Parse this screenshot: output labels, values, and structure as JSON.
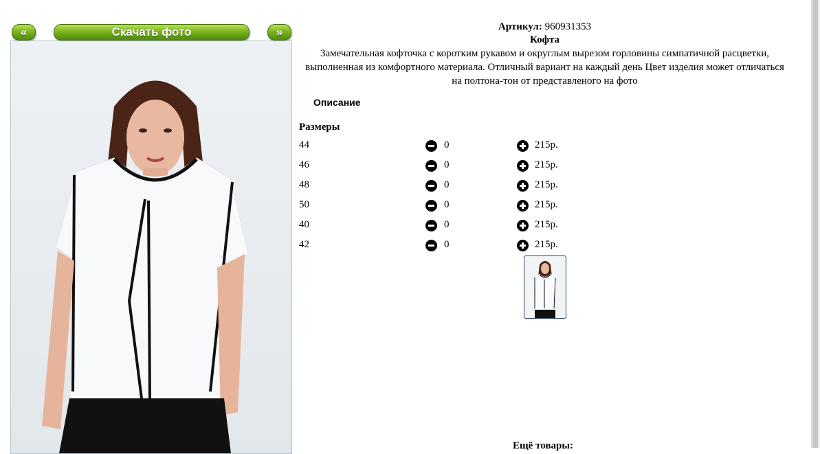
{
  "nav": {
    "prev_label": "«",
    "download_label": "Скачать фото",
    "next_label": "»"
  },
  "product": {
    "article_label": "Артикул:",
    "article_value": "960931353",
    "title": "Кофта",
    "description": "Замечательная кофточка с коротким рукавом и округлым вырезом горловины симпатичной расцветки, выполненная из комфортного материала. Отличный вариант на каждый день Цвет изделия может отличаться на полтона-тон от представленого на фото",
    "description_link": "Описание"
  },
  "sizes": {
    "title": "Размеры",
    "rows": [
      {
        "size": "44",
        "qty": "0",
        "price": "215р."
      },
      {
        "size": "46",
        "qty": "0",
        "price": "215р."
      },
      {
        "size": "48",
        "qty": "0",
        "price": "215р."
      },
      {
        "size": "50",
        "qty": "0",
        "price": "215р."
      },
      {
        "size": "40",
        "qty": "0",
        "price": "215р."
      },
      {
        "size": "42",
        "qty": "0",
        "price": "215р."
      }
    ]
  },
  "more_products": "Ещё товары:",
  "colors": {
    "button_green": "#7cb51f",
    "outline": "#2b3f57"
  }
}
